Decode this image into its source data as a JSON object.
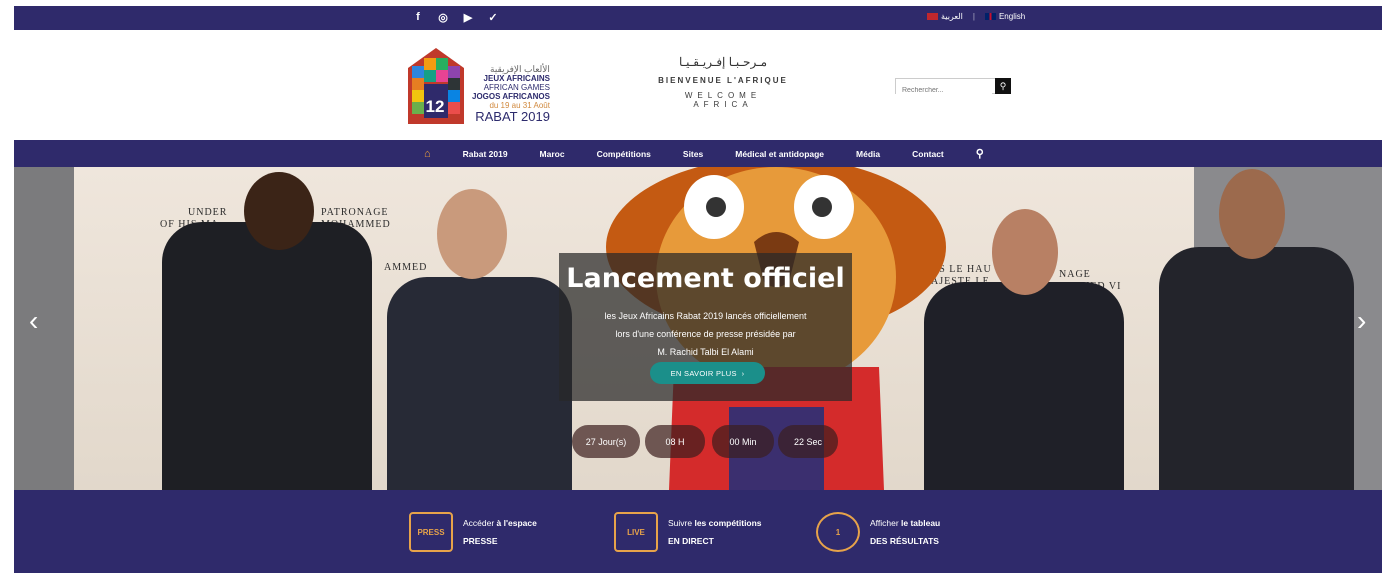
{
  "topbar": {
    "social": [
      "facebook-icon",
      "instagram-icon",
      "youtube-icon",
      "twitter-icon"
    ],
    "social_glyphs": [
      "f",
      "◎",
      "▶",
      "✓"
    ],
    "lang_ar": "العربية",
    "lang_en": "English"
  },
  "logo": {
    "ar": "الألعاب الإفريقية",
    "line1": "JEUX AFRICAINS",
    "line2": "AFRICAN GAMES",
    "line3": "JOGOS AFRICANOS",
    "dates": "du 19 au 31 Août",
    "city": "RABAT 2019",
    "badge": "12"
  },
  "welcome": {
    "ar": "مـرحـبـا إفـريـقـيـا",
    "fr": "BIENVENUE L'AFRIQUE",
    "en": "WELCOME AFRICA"
  },
  "search": {
    "placeholder": "Rechercher..."
  },
  "nav": {
    "items": [
      "Rabat 2019",
      "Maroc",
      "Compétitions",
      "Sites",
      "Médical et antidopage",
      "Média",
      "Contact"
    ]
  },
  "hero": {
    "banner_left_1": "UNDER",
    "banner_left_2": "OF HIS MA",
    "banner_left_3": "PATRONAGE",
    "banner_left_4": "MOHAMMED",
    "banner_left_5": "AMMED",
    "banner_right_1": "VS LE HAU",
    "banner_right_2": "NAGE",
    "banner_right_3": "AJESTE LE",
    "banner_right_4": "HAMMED VI",
    "title": "Lancement officiel",
    "text_1": "les Jeux Africains Rabat 2019 lancés officiellement",
    "text_2": "lors d'une conférence de presse présidée par",
    "text_3": "M. Rachid Talbi El Alami",
    "cta": "EN SAVOIR PLUS",
    "timer": [
      "27 Jour(s)",
      "08  H",
      "00  Min",
      "22  Sec"
    ]
  },
  "footer": {
    "items": [
      {
        "icon": "PRESS",
        "pre": "Accéder ",
        "bold": "à l'espace",
        "sub": "PRESSE"
      },
      {
        "icon": "LIVE",
        "pre": "Suivre ",
        "bold": "les compétitions",
        "sub": "EN DIRECT"
      },
      {
        "icon": "1",
        "pre": "Afficher ",
        "bold": "le tableau",
        "sub": "DES RÉSULTATS"
      }
    ]
  },
  "colors": {
    "primary": "#2f2a6b",
    "accent": "#f0a23a",
    "cta": "#1b8f8a"
  }
}
